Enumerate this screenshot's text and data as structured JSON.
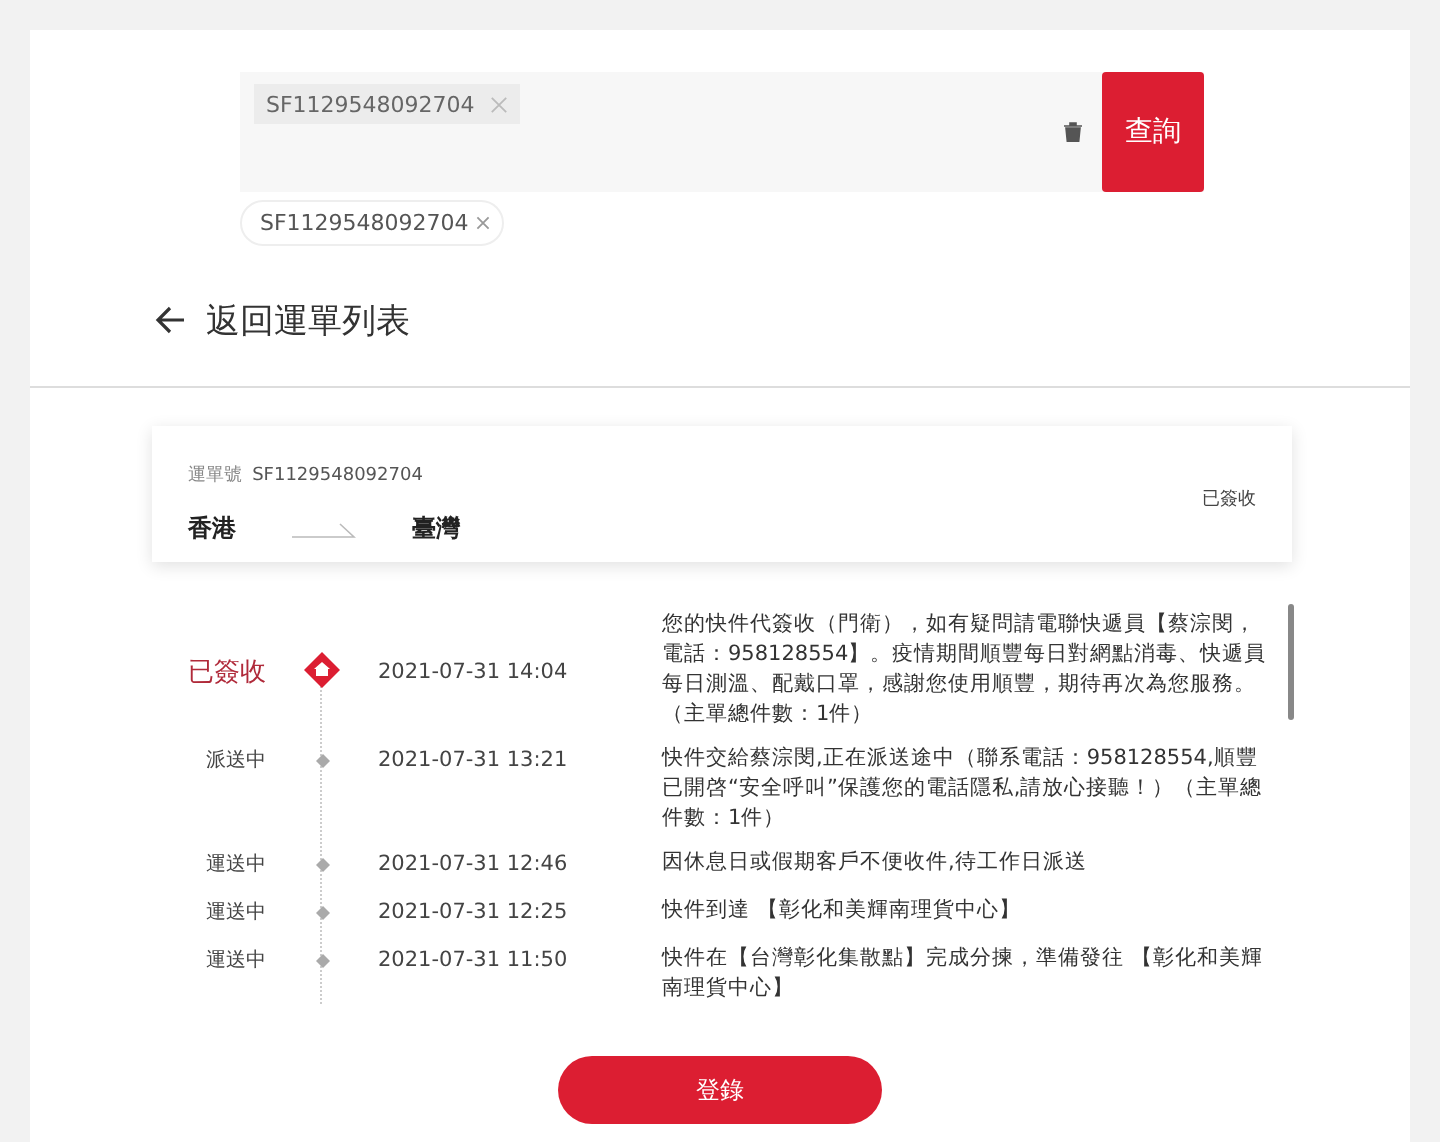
{
  "search": {
    "tags": [
      "SF1129548092704"
    ],
    "button": "查詢"
  },
  "history_chips": [
    "SF1129548092704"
  ],
  "back_link": "返回運單列表",
  "waybill": {
    "label": "運單號",
    "number": "SF1129548092704",
    "origin": "香港",
    "destination": "臺灣",
    "status": "已簽收"
  },
  "events": [
    {
      "status": "已簽收",
      "time": "2021-07-31 14:04",
      "description": "您的快件代簽收（門衛），如有疑問請電聯快遞員【蔡淙閔，電話：958128554】。疫情期間順豐每日對網點消毒、快遞員每日測溫、配戴口罩，感謝您使用順豐，期待再次為您服務。（主單總件數：1件）",
      "current": true
    },
    {
      "status": "派送中",
      "time": "2021-07-31 13:21",
      "description": "快件交給蔡淙閔,正在派送途中（聯系電話：958128554,順豐已開啓“安全呼叫”保護您的電話隱私,請放心接聽！）（主單總件數：1件）",
      "current": false
    },
    {
      "status": "運送中",
      "time": "2021-07-31 12:46",
      "description": "因休息日或假期客戶不便收件,待工作日派送",
      "current": false
    },
    {
      "status": "運送中",
      "time": "2021-07-31 12:25",
      "description": "快件到達 【彰化和美輝南理貨中心】",
      "current": false
    },
    {
      "status": "運送中",
      "time": "2021-07-31 11:50",
      "description": "快件在【台灣彰化集散點】完成分揀，準備發往 【彰化和美輝南理貨中心】",
      "current": false
    }
  ],
  "login_button": "登錄"
}
